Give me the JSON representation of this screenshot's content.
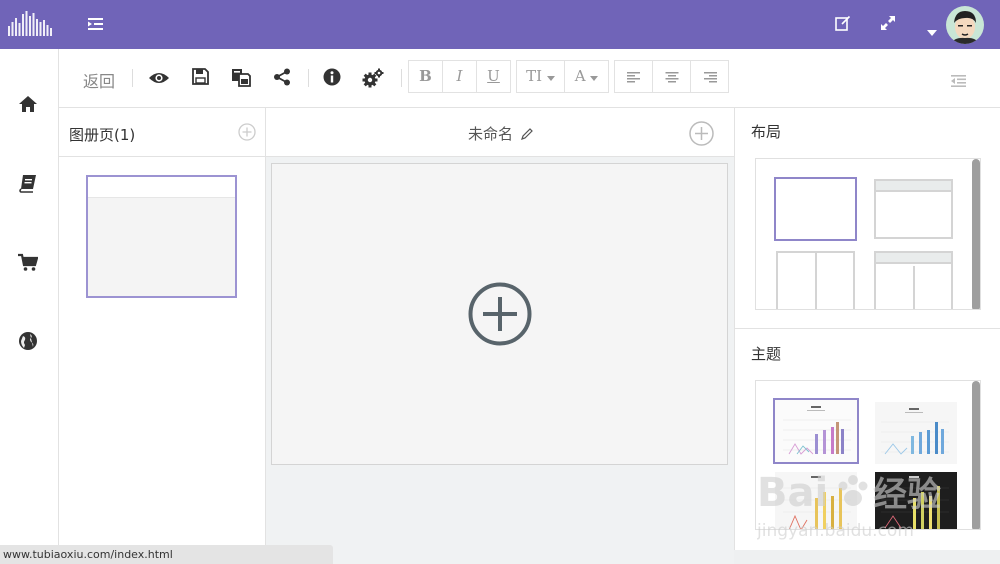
{
  "colors": {
    "topbar": "#7064b8",
    "accent": "#8f86c9"
  },
  "topbar": {
    "logo_icon": "soundwave-logo-icon",
    "menu_icon": "menu-indent-icon",
    "edit_icon": "edit-icon",
    "fullscreen_icon": "expand-icon",
    "caret_icon": "caret-down-icon",
    "avatar_icon": "avatar"
  },
  "sidebar": {
    "items": [
      {
        "icon": "home-icon"
      },
      {
        "icon": "book-icon"
      },
      {
        "icon": "cart-icon"
      },
      {
        "icon": "globe-icon"
      }
    ]
  },
  "toolbar": {
    "back_label": "返回",
    "preview_icon": "eye-icon",
    "save_icon": "save-icon",
    "copy_icon": "copy-icon",
    "share_icon": "share-icon",
    "info_icon": "info-icon",
    "settings_icon": "gears-icon",
    "bold_label": "B",
    "italic_label": "I",
    "underline_label": "U",
    "font_size_label": "TI",
    "font_color_label": "A",
    "align_left_icon": "align-left-icon",
    "align_center_icon": "align-center-icon",
    "align_right_icon": "align-right-icon",
    "panel_toggle_icon": "outdent-icon"
  },
  "pages": {
    "title": "图册页(1)",
    "add_icon": "plus-circle-icon"
  },
  "canvas": {
    "doc_title": "未命名",
    "rename_icon": "pencil-icon",
    "add_icon": "plus-circle-icon"
  },
  "layout_panel": {
    "title": "布局"
  },
  "theme_panel": {
    "title": "主题"
  },
  "status_bar": {
    "url": "www.tubiaoxiu.com/index.html"
  }
}
